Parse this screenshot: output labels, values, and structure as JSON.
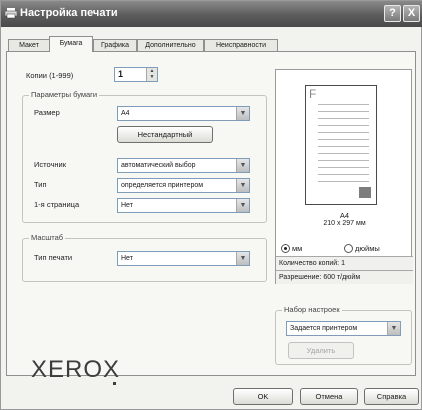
{
  "window": {
    "title": "Настройка печати",
    "help_label": "?",
    "close_label": "X"
  },
  "tabs": [
    {
      "label": "Макет",
      "active": false
    },
    {
      "label": "Бумага",
      "active": true
    },
    {
      "label": "Графика",
      "active": false
    },
    {
      "label": "Дополнительно",
      "active": false
    },
    {
      "label": "Неисправности",
      "active": false
    }
  ],
  "copies": {
    "label": "Копии (1-999)",
    "value": "1",
    "up": "▲",
    "down": "▼"
  },
  "paper_group": {
    "title": "Параметры бумаги",
    "size_label": "Размер",
    "size_value": "A4",
    "custom_button": "Нестандартный",
    "source_label": "Источник",
    "source_value": "автоматический выбор",
    "type_label": "Тип",
    "type_value": "определяется принтером",
    "first_page_label": "1-я страница",
    "first_page_value": "Нет"
  },
  "scale_group": {
    "title": "Масштаб",
    "print_type_label": "Тип печати",
    "print_type_value": "Нет"
  },
  "preview": {
    "page_letter": "F",
    "size_name": "A4",
    "size_dims": "210 x 297 мм",
    "unit_mm": "мм",
    "unit_inch": "дюймы",
    "copies_info": "Количество копий: 1",
    "resolution_info": "Разрешение: 600 т/дюйм"
  },
  "favorites": {
    "title": "Набор настроек",
    "value": "Задается принтером",
    "delete_button": "Удалить"
  },
  "logo": {
    "text": "XEROX"
  },
  "footer": {
    "ok": "OK",
    "cancel": "Отмена",
    "help": "Справка"
  },
  "icons": {
    "dropdown": "▼"
  }
}
